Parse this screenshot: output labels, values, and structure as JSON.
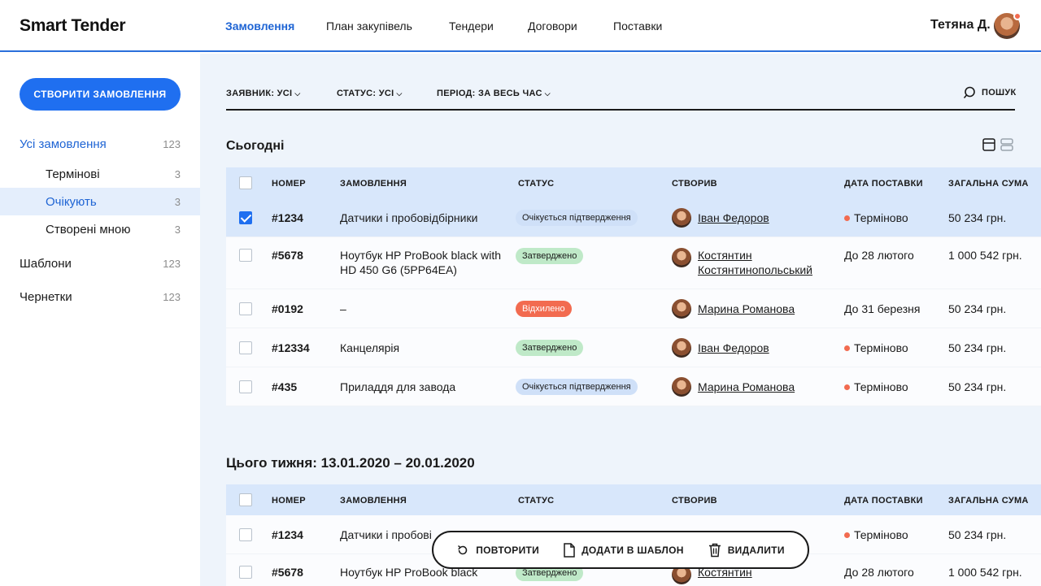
{
  "brand": "Smart Tender",
  "nav": [
    "Замовлення",
    "План закупівель",
    "Тендери",
    "Договори",
    "Поставки"
  ],
  "user": {
    "name": "Тетяна Д."
  },
  "sidebar": {
    "create_button": "СТВОРИТИ ЗАМОВЛЕННЯ",
    "items": [
      {
        "label": "Усі замовлення",
        "count": "123"
      },
      {
        "label": "Термінові",
        "count": "3"
      },
      {
        "label": "Очікують",
        "count": "3"
      },
      {
        "label": "Створені мною",
        "count": "3"
      },
      {
        "label": "Шаблони",
        "count": "123"
      },
      {
        "label": "Чернетки",
        "count": "123"
      }
    ]
  },
  "filters": {
    "applicant": "ЗАЯВНИК: УСІ",
    "status": "СТАТУС: УСІ",
    "period": "ПЕРІОД: ЗА ВЕСЬ ЧАС",
    "search": "ПОШУК"
  },
  "columns": [
    "НОМЕР",
    "ЗАМОВЛЕННЯ",
    "СТАТУС",
    "СТВОРИВ",
    "ДАТА ПОСТАВКИ",
    "ЗАГАЛЬНА СУМА"
  ],
  "today": {
    "title": "Сьогодні",
    "rows": [
      {
        "num": "#1234",
        "order": "Датчики і пробовідбірники",
        "status": "Очікується підтвердження",
        "creator": "Іван Федоров",
        "date": "Терміново",
        "sum": "50 234 грн."
      },
      {
        "num": "#5678",
        "order": "Ноутбук HP ProBook black with HD 450 G6 (5PP64EA)",
        "status": "Затверджено",
        "creator": "Костянтин Костянтинопольський",
        "date": "До 28 лютого",
        "sum": "1 000 542 грн."
      },
      {
        "num": "#0192",
        "order": "–",
        "status": "Відхилено",
        "creator": "Марина Романова",
        "date": "До 31 березня",
        "sum": "50 234 грн."
      },
      {
        "num": "#12334",
        "order": "Канцелярія",
        "status": "Затверджено",
        "creator": "Іван Федоров",
        "date": "Терміново",
        "sum": "50 234 грн."
      },
      {
        "num": "#435",
        "order": "Приладдя для завода",
        "status": "Очікується підтвердження",
        "creator": "Марина Романова",
        "date": "Терміново",
        "sum": "50 234 грн."
      }
    ]
  },
  "week": {
    "title": "Цього тижня: 13.01.2020 – 20.01.2020",
    "rows": [
      {
        "num": "#1234",
        "order": "Датчики і пробові",
        "date": "Терміново",
        "sum": "50 234 грн."
      },
      {
        "num": "#5678",
        "order": "Ноутбук HP ProBook black",
        "status": "Затверджено",
        "creator": "Костянтин",
        "date": "До 28 лютого",
        "sum": "1 000 542 грн."
      }
    ]
  },
  "actions": {
    "repeat": "ПОВТОРИТИ",
    "add_template": "ДОДАТИ В ШАБЛОН",
    "delete": "ВИДАЛИТИ"
  }
}
